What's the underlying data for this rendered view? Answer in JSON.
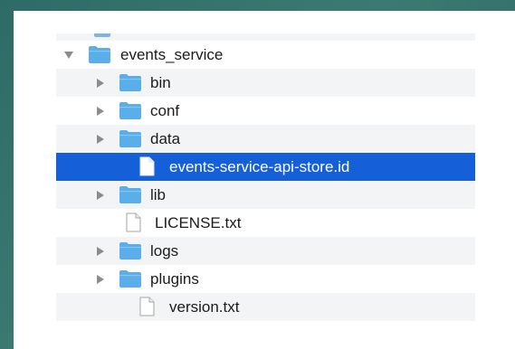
{
  "colors": {
    "folder": "#5aaeea",
    "selection": "#1560d8",
    "stripe": "#f3f4f6",
    "desktop": "#2f6b66"
  },
  "tree": {
    "root": {
      "label": "events_service",
      "icon": "folder-icon",
      "expanded": true
    },
    "children": [
      {
        "label": "bin",
        "icon": "folder-icon",
        "expandable": true
      },
      {
        "label": "conf",
        "icon": "folder-icon",
        "expandable": true
      },
      {
        "label": "data",
        "icon": "folder-icon",
        "expandable": true
      },
      {
        "label": "events-service-api-store.id",
        "icon": "document-icon",
        "expandable": false,
        "selected": true
      },
      {
        "label": "lib",
        "icon": "folder-icon",
        "expandable": true
      },
      {
        "label": "LICENSE.txt",
        "icon": "document-icon",
        "expandable": false
      },
      {
        "label": "logs",
        "icon": "folder-icon",
        "expandable": true
      },
      {
        "label": "plugins",
        "icon": "folder-icon",
        "expandable": true
      },
      {
        "label": "version.txt",
        "icon": "document-icon",
        "expandable": false
      }
    ]
  }
}
